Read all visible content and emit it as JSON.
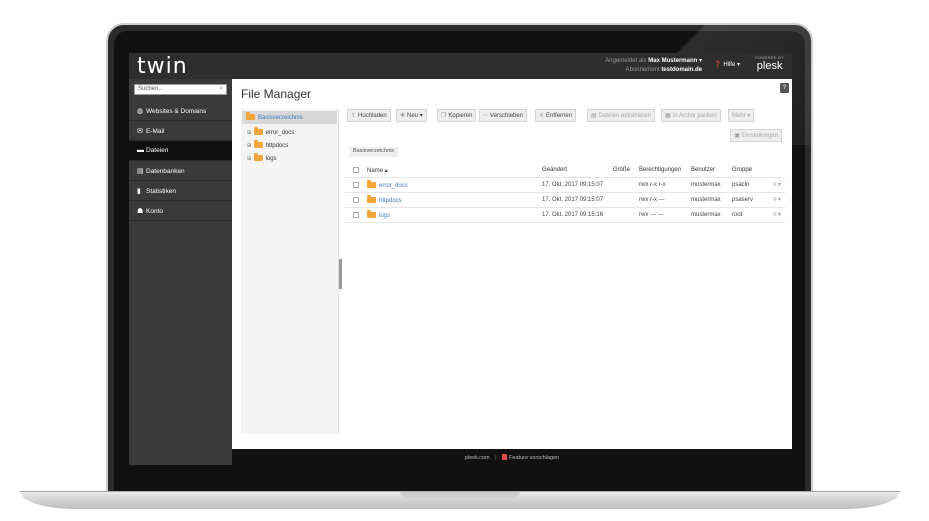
{
  "brand": {
    "logo": "twin",
    "powered_by": "POWERED BY",
    "plesk": "plesk"
  },
  "account": {
    "logged_in_label": "Angemeldet als",
    "user": "Max Mustermann ▾",
    "subscription_label": "Abonnement",
    "subscription": "testdomain.de",
    "help": "Hilfe ▾"
  },
  "search": {
    "placeholder": "Suchen..."
  },
  "sidebar": {
    "items": [
      {
        "label": "Websites & Domains",
        "icon": "globe-icon"
      },
      {
        "label": "E-Mail",
        "icon": "mail-icon"
      },
      {
        "label": "Dateien",
        "icon": "folder-icon",
        "active": true
      },
      {
        "label": "Datenbanken",
        "icon": "database-icon"
      },
      {
        "label": "Statistiken",
        "icon": "bar-chart-icon"
      },
      {
        "label": "Konto",
        "icon": "account-icon"
      }
    ]
  },
  "page": {
    "title": "File Manager",
    "help": "?"
  },
  "tree": {
    "root": "Basisverzeichnis",
    "items": [
      "error_docs",
      "httpdocs",
      "logs"
    ]
  },
  "toolbar": {
    "upload": "Hochladen",
    "new": "Neu ▾",
    "copy": "Kopieren",
    "move": "Verschieben",
    "remove": "Entfernen",
    "extract": "Dateien extrahieren",
    "archive": "In Archiv packen",
    "more": "Mehr ▾",
    "settings": "Einstellungen"
  },
  "breadcrumb": "Basisverzeichnis",
  "table": {
    "headers": {
      "name": "Name ▴",
      "changed": "Geändert",
      "size": "Größe",
      "perms": "Berechtigungen",
      "user": "Benutzer",
      "group": "Gruppe"
    },
    "rows": [
      {
        "name": "error_docs",
        "changed": "17. Okt. 2017 09:15:07",
        "perms": "rwx r-x r-x",
        "user": "mustermax",
        "group": "psacln",
        "menu": "≡ ▾"
      },
      {
        "name": "httpdocs",
        "changed": "17. Okt. 2017 09:15:07",
        "perms": "rwx r-x ---",
        "user": "mustermax",
        "group": "psaserv",
        "menu": "≡ ▾"
      },
      {
        "name": "logs",
        "changed": "17. Okt. 2017 09:15:16",
        "perms": "rwx --- ---",
        "user": "mustermax",
        "group": "root",
        "menu": "≡ ▾"
      }
    ]
  },
  "footer": {
    "link1": "plesk.com",
    "sep": "|",
    "link2": "Feature vorschlagen"
  },
  "colors": {
    "accent": "#3a7bbf",
    "folder": "#f3a53a",
    "sidebar": "#3a3a3a",
    "active": "#111111"
  }
}
